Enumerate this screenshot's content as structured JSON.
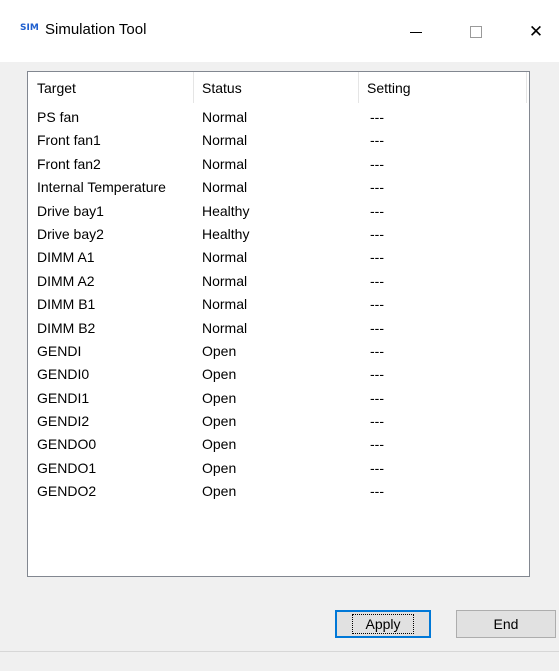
{
  "window": {
    "app_icon_text": "SIM",
    "title": "Simulation Tool",
    "close_glyph": "✕"
  },
  "list": {
    "columns": [
      "Target",
      "Status",
      "Setting"
    ],
    "rows": [
      {
        "target": "PS fan",
        "status": "Normal",
        "setting": "---"
      },
      {
        "target": "Front fan1",
        "status": "Normal",
        "setting": "---"
      },
      {
        "target": "Front fan2",
        "status": "Normal",
        "setting": "---"
      },
      {
        "target": "Internal Temperature",
        "status": "Normal",
        "setting": "---"
      },
      {
        "target": "Drive bay1",
        "status": "Healthy",
        "setting": "---"
      },
      {
        "target": "Drive bay2",
        "status": "Healthy",
        "setting": "---"
      },
      {
        "target": "DIMM A1",
        "status": "Normal",
        "setting": "---"
      },
      {
        "target": "DIMM A2",
        "status": "Normal",
        "setting": "---"
      },
      {
        "target": "DIMM B1",
        "status": "Normal",
        "setting": "---"
      },
      {
        "target": "DIMM B2",
        "status": "Normal",
        "setting": "---"
      },
      {
        "target": "GENDI",
        "status": "Open",
        "setting": "---"
      },
      {
        "target": "GENDI0",
        "status": "Open",
        "setting": "---"
      },
      {
        "target": "GENDI1",
        "status": "Open",
        "setting": "---"
      },
      {
        "target": "GENDI2",
        "status": "Open",
        "setting": "---"
      },
      {
        "target": "GENDO0",
        "status": "Open",
        "setting": "---"
      },
      {
        "target": "GENDO1",
        "status": "Open",
        "setting": "---"
      },
      {
        "target": "GENDO2",
        "status": "Open",
        "setting": "---"
      }
    ]
  },
  "buttons": {
    "apply": "Apply",
    "end": "End"
  },
  "colors": {
    "accent": "#0078d7",
    "window_bg": "#f0f0f0"
  }
}
